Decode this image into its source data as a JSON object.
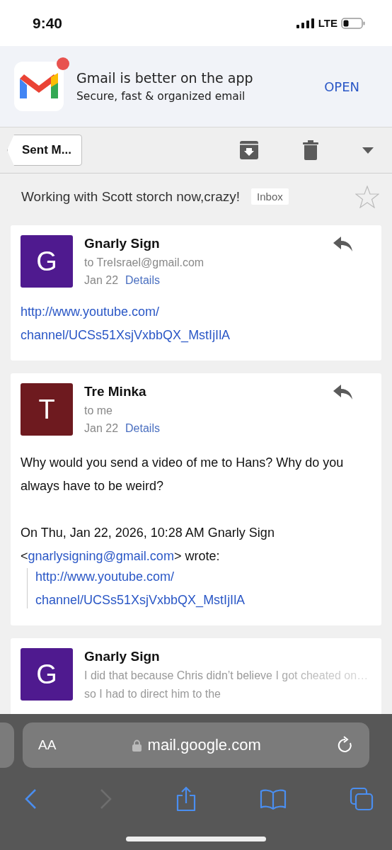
{
  "status_bar": {
    "time": "9:40",
    "network": "LTE"
  },
  "app_banner": {
    "title": "Gmail is better on the app",
    "subtitle": "Secure, fast & organized email",
    "action": "OPEN",
    "notification_dot": true
  },
  "toolbar": {
    "back_label": "Sent M..."
  },
  "subject": {
    "text": "Working with Scott storch now,crazy!",
    "label": "Inbox",
    "starred": false
  },
  "messages": [
    {
      "kind": "full",
      "initial": "G",
      "color": "#4f1a8f",
      "sender": "Gnarly Sign",
      "recipient": "to TreIsrael@gmail.com",
      "date": "Jan 22",
      "details": "Details",
      "link_lines": [
        "http://www.youtube.com/",
        "channel/UCSs51XsjVxbbQX_MstIjIlA"
      ]
    },
    {
      "kind": "full",
      "initial": "T",
      "color": "#6e1a1f",
      "sender": "Tre Minka",
      "recipient": "to me",
      "date": "Jan 22",
      "details": "Details",
      "body_text": "Why would you send a video of me to Hans? Why do you always have to be weird?",
      "attribution_before": "On Thu, Jan 22, 2026, 10:28 AM Gnarly Sign <",
      "attribution_email": "gnarlysigning@gmail.com",
      "attribution_after": "> wrote:",
      "quoted_link_lines": [
        "http://www.youtube.com/",
        "channel/UCSs51XsjVxbbQX_MstIjIlA"
      ]
    },
    {
      "kind": "collapsed",
      "initial": "G",
      "color": "#4f1a8f",
      "sender": "Gnarly Sign",
      "snippet": "I did that because Chris didn’t believe I got cheated on…so I had to direct him to the"
    }
  ],
  "browser": {
    "text_size": "AA",
    "address": "mail.google.com",
    "back_disabled": false,
    "forward_disabled": true
  }
}
